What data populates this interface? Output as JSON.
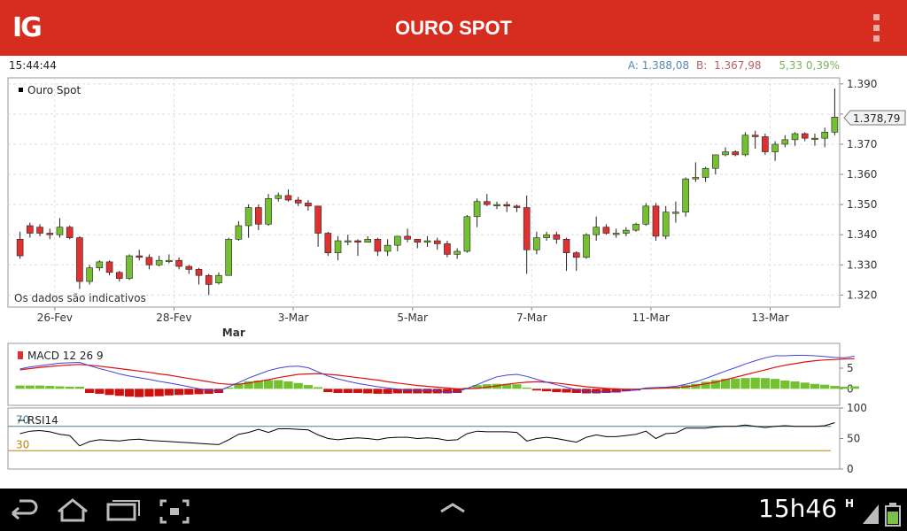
{
  "header": {
    "logo": "IG",
    "title": "OURO SPOT",
    "menu_icon": "overflow-menu-icon"
  },
  "info": {
    "time": "15:44:44",
    "ask_label": "A:",
    "ask": "1.388,08",
    "bid_label": "B:",
    "bid": "1.367,98",
    "change": "5,33 0,39%"
  },
  "colors": {
    "accent": "#d62d20",
    "up": "#73c030",
    "down": "#e03131",
    "macd": "#4040e0",
    "signal": "#e01010",
    "rsi": "#000000"
  },
  "chart_data": [
    {
      "type": "candlestick",
      "legend": "Ouro Spot",
      "note": "Os dados são indicativos",
      "current_price_label": "1.378,79",
      "current_price": 1378.79,
      "ylim": [
        1316,
        1392
      ],
      "y_ticks": [
        1320,
        1330,
        1340,
        1350,
        1360,
        1370,
        1380,
        1390
      ],
      "y_tick_labels": [
        "1.320",
        "1.330",
        "1.340",
        "1.350",
        "1.360",
        "1.370",
        "1.380",
        "1.390"
      ],
      "x_labels": [
        "26-Fev",
        "28-Fev",
        "3-Mar",
        "5-Mar",
        "7-Mar",
        "11-Mar",
        "13-Mar"
      ],
      "x_label_positions": [
        3.5,
        15.5,
        27.5,
        39.5,
        51.5,
        63.5,
        75.5
      ],
      "month_label": "Mar",
      "month_label_position": 21.5,
      "candles": [
        [
          1338.5,
          1333.0,
          1341.0,
          1332.0
        ],
        [
          1343.0,
          1340.5,
          1344.0,
          1339.0
        ],
        [
          1342.5,
          1340.5,
          1343.5,
          1339.5
        ],
        [
          1340.5,
          1340.0,
          1342.0,
          1338.5
        ],
        [
          1340.0,
          1342.5,
          1345.5,
          1339.0
        ],
        [
          1342.5,
          1339.0,
          1343.0,
          1338.5
        ],
        [
          1339.0,
          1324.5,
          1339.5,
          1322.0
        ],
        [
          1324.5,
          1329.0,
          1330.0,
          1323.5
        ],
        [
          1329.0,
          1331.0,
          1331.5,
          1328.0
        ],
        [
          1331.0,
          1327.5,
          1331.5,
          1326.5
        ],
        [
          1327.5,
          1325.5,
          1328.0,
          1324.5
        ],
        [
          1325.5,
          1333.0,
          1333.5,
          1325.0
        ],
        [
          1333.0,
          1332.5,
          1335.0,
          1331.5
        ],
        [
          1332.5,
          1330.0,
          1333.5,
          1328.5
        ],
        [
          1330.0,
          1331.5,
          1333.0,
          1329.5
        ],
        [
          1331.5,
          1331.5,
          1333.5,
          1330.5
        ],
        [
          1331.5,
          1329.5,
          1332.5,
          1328.5
        ],
        [
          1329.5,
          1328.5,
          1330.0,
          1327.0
        ],
        [
          1328.5,
          1326.5,
          1329.0,
          1323.5
        ],
        [
          1326.5,
          1323.5,
          1327.0,
          1320.0
        ],
        [
          1324.0,
          1326.5,
          1327.5,
          1323.5
        ],
        [
          1326.5,
          1338.5,
          1339.0,
          1326.5
        ],
        [
          1338.5,
          1343.0,
          1344.5,
          1338.0
        ],
        [
          1343.0,
          1349.0,
          1350.0,
          1339.0
        ],
        [
          1349.0,
          1343.5,
          1350.0,
          1341.5
        ],
        [
          1343.5,
          1352.0,
          1353.5,
          1343.0
        ],
        [
          1352.0,
          1353.0,
          1354.0,
          1351.0
        ],
        [
          1353.0,
          1351.5,
          1355.0,
          1351.0
        ],
        [
          1351.5,
          1350.5,
          1352.5,
          1349.5
        ],
        [
          1350.5,
          1349.5,
          1351.5,
          1348.0
        ],
        [
          1349.5,
          1340.5,
          1349.5,
          1336.0
        ],
        [
          1340.5,
          1334.0,
          1341.0,
          1333.0
        ],
        [
          1334.0,
          1338.0,
          1339.5,
          1331.5
        ],
        [
          1338.0,
          1338.0,
          1340.0,
          1336.5
        ],
        [
          1338.0,
          1337.5,
          1338.5,
          1333.0
        ],
        [
          1337.5,
          1338.5,
          1339.5,
          1337.5
        ],
        [
          1338.5,
          1334.5,
          1339.0,
          1333.0
        ],
        [
          1334.5,
          1336.5,
          1338.5,
          1333.0
        ],
        [
          1336.5,
          1339.5,
          1339.5,
          1334.5
        ],
        [
          1339.5,
          1338.5,
          1342.0,
          1337.5
        ],
        [
          1338.5,
          1337.5,
          1338.5,
          1335.5
        ],
        [
          1337.5,
          1338.0,
          1339.5,
          1336.0
        ],
        [
          1338.0,
          1337.0,
          1339.0,
          1335.0
        ],
        [
          1337.0,
          1333.5,
          1338.0,
          1332.5
        ],
        [
          1333.5,
          1334.5,
          1335.5,
          1332.0
        ],
        [
          1334.5,
          1346.0,
          1346.5,
          1334.0
        ],
        [
          1346.0,
          1351.0,
          1352.0,
          1342.5
        ],
        [
          1351.0,
          1350.0,
          1353.5,
          1349.5
        ],
        [
          1350.0,
          1350.0,
          1351.0,
          1348.5
        ],
        [
          1350.0,
          1349.5,
          1351.0,
          1347.5
        ],
        [
          1349.5,
          1349.0,
          1350.0,
          1347.5
        ],
        [
          1349.0,
          1335.0,
          1353.0,
          1327.0
        ],
        [
          1335.0,
          1339.0,
          1341.0,
          1333.5
        ],
        [
          1339.0,
          1340.0,
          1341.0,
          1338.0
        ],
        [
          1340.0,
          1338.5,
          1341.0,
          1337.0
        ],
        [
          1338.5,
          1334.0,
          1339.0,
          1328.0
        ],
        [
          1334.0,
          1332.5,
          1334.5,
          1328.0
        ],
        [
          1332.5,
          1340.0,
          1340.5,
          1332.0
        ],
        [
          1340.0,
          1342.5,
          1346.0,
          1338.0
        ],
        [
          1342.5,
          1340.5,
          1343.5,
          1340.0
        ],
        [
          1340.5,
          1340.5,
          1342.0,
          1339.0
        ],
        [
          1340.5,
          1341.5,
          1342.5,
          1339.5
        ],
        [
          1341.5,
          1343.5,
          1344.0,
          1341.0
        ],
        [
          1343.5,
          1349.5,
          1350.5,
          1343.0
        ],
        [
          1349.5,
          1339.5,
          1350.5,
          1338.0
        ],
        [
          1339.5,
          1347.5,
          1349.5,
          1338.5
        ],
        [
          1347.5,
          1347.5,
          1351.0,
          1344.0
        ],
        [
          1347.5,
          1358.5,
          1359.0,
          1346.0
        ],
        [
          1358.5,
          1359.0,
          1364.0,
          1357.5
        ],
        [
          1359.0,
          1362.0,
          1362.5,
          1357.5
        ],
        [
          1362.0,
          1366.5,
          1366.5,
          1360.0
        ],
        [
          1366.5,
          1367.5,
          1369.0,
          1366.0
        ],
        [
          1367.5,
          1366.5,
          1368.0,
          1366.0
        ],
        [
          1366.5,
          1373.0,
          1374.0,
          1366.0
        ],
        [
          1373.0,
          1372.5,
          1374.5,
          1368.5
        ],
        [
          1372.5,
          1367.5,
          1373.5,
          1366.5
        ],
        [
          1367.5,
          1370.0,
          1371.0,
          1364.5
        ],
        [
          1370.0,
          1371.5,
          1373.0,
          1369.0
        ],
        [
          1371.5,
          1373.5,
          1374.0,
          1369.5
        ],
        [
          1373.5,
          1372.0,
          1374.0,
          1371.0
        ],
        [
          1372.0,
          1372.0,
          1373.5,
          1369.5
        ],
        [
          1372.0,
          1374.0,
          1375.5,
          1369.0
        ],
        [
          1374.0,
          1379.0,
          1388.5,
          1373.0
        ]
      ]
    },
    {
      "type": "line",
      "legend": "MACD 12 26 9",
      "ylim": [
        -4,
        11
      ],
      "y_ticks": [
        0,
        5
      ],
      "y_tick_labels": [
        "0",
        "5"
      ],
      "macd": [
        4.8,
        5.3,
        5.6,
        5.9,
        6.2,
        6.3,
        6.4,
        5.6,
        4.9,
        4.3,
        3.6,
        3.1,
        2.7,
        2.3,
        1.8,
        1.4,
        1.0,
        0.5,
        0.0,
        -0.4,
        -0.6,
        0.5,
        1.5,
        2.6,
        3.5,
        4.4,
        5.0,
        5.4,
        5.5,
        5.1,
        4.1,
        3.1,
        2.4,
        1.8,
        1.3,
        0.9,
        0.5,
        0.2,
        -0.1,
        -0.3,
        -0.4,
        -0.4,
        -0.5,
        -0.8,
        -0.7,
        0.1,
        1.0,
        2.0,
        2.9,
        3.3,
        3.5,
        3.0,
        2.3,
        1.6,
        1.0,
        0.4,
        -0.2,
        -0.6,
        -0.7,
        -0.7,
        -0.6,
        -0.5,
        -0.3,
        0.2,
        0.3,
        0.4,
        0.6,
        1.1,
        1.7,
        2.5,
        3.4,
        4.3,
        5.1,
        6.0,
        6.8,
        7.5,
        8.0,
        8.0,
        8.1,
        8.1,
        8.0,
        7.8,
        7.6,
        7.5,
        7.9
      ],
      "signal": [
        4.6,
        4.9,
        5.2,
        5.4,
        5.6,
        5.8,
        5.9,
        5.7,
        5.5,
        5.2,
        4.9,
        4.6,
        4.3,
        4.0,
        3.6,
        3.3,
        2.9,
        2.5,
        2.1,
        1.7,
        1.3,
        1.1,
        1.1,
        1.4,
        1.8,
        2.2,
        2.7,
        3.1,
        3.5,
        3.6,
        3.7,
        3.5,
        3.3,
        3.0,
        2.7,
        2.4,
        2.1,
        1.7,
        1.4,
        1.1,
        0.8,
        0.6,
        0.4,
        0.2,
        0.0,
        0.0,
        0.1,
        0.4,
        0.7,
        1.1,
        1.4,
        1.6,
        1.7,
        1.6,
        1.4,
        1.1,
        0.8,
        0.5,
        0.3,
        0.1,
        0.0,
        -0.1,
        -0.1,
        0.0,
        0.1,
        0.2,
        0.3,
        0.5,
        0.8,
        1.2,
        1.6,
        2.2,
        2.8,
        3.4,
        4.0,
        4.6,
        5.2,
        5.7,
        6.1,
        6.5,
        6.8,
        7.0,
        7.1,
        7.2,
        7.3
      ],
      "histogram": [
        0.8,
        0.8,
        0.8,
        0.7,
        0.6,
        0.5,
        0.5,
        -1.0,
        -1.2,
        -1.5,
        -1.7,
        -1.9,
        -2.0,
        -1.9,
        -1.8,
        -1.6,
        -1.5,
        -1.4,
        -1.3,
        -1.2,
        -1.0,
        0.3,
        1.3,
        1.8,
        2.0,
        2.1,
        2.1,
        1.8,
        1.4,
        0.9,
        0.4,
        -0.8,
        -1.0,
        -1.0,
        -1.0,
        -1.1,
        -1.2,
        -1.2,
        -1.1,
        -1.1,
        -1.1,
        -1.1,
        -1.1,
        -1.1,
        -1.0,
        0.3,
        0.9,
        1.1,
        1.2,
        1.2,
        1.1,
        0.3,
        -0.4,
        -0.6,
        -0.8,
        -0.9,
        -1.0,
        -1.1,
        -1.1,
        -1.0,
        -0.9,
        -0.6,
        -0.4,
        0.2,
        0.3,
        0.4,
        0.5,
        0.9,
        1.2,
        1.7,
        2.1,
        2.4,
        2.5,
        2.6,
        2.7,
        2.6,
        2.4,
        2.0,
        1.8,
        1.5,
        1.2,
        1.0,
        0.7,
        0.5,
        0.6
      ]
    },
    {
      "type": "line",
      "legend": "RSI14",
      "ylim": [
        0,
        100
      ],
      "y_ticks": [
        0,
        50,
        100
      ],
      "y_tick_labels": [
        "0",
        "50",
        "100"
      ],
      "levels": [
        70,
        30
      ],
      "level_labels": [
        "70",
        "30"
      ],
      "values": [
        58,
        62,
        63,
        61,
        57,
        55,
        38,
        45,
        48,
        47,
        46,
        48,
        49,
        47,
        46,
        45,
        44,
        43,
        42,
        41,
        40,
        48,
        57,
        60,
        65,
        60,
        66,
        66,
        65,
        64,
        56,
        50,
        48,
        50,
        51,
        50,
        48,
        51,
        52,
        52,
        50,
        51,
        50,
        47,
        48,
        58,
        62,
        61,
        61,
        61,
        60,
        46,
        50,
        52,
        50,
        47,
        44,
        52,
        56,
        53,
        53,
        55,
        57,
        62,
        50,
        58,
        59,
        67,
        67,
        67,
        69,
        70,
        70,
        72,
        70,
        68,
        70,
        71,
        70,
        70,
        70,
        71,
        76
      ]
    }
  ],
  "nav": {
    "clock": "15h46",
    "back_icon": "back-icon",
    "home_icon": "home-icon",
    "recents_icon": "recent-apps-icon",
    "screenshot_icon": "screenshot-icon",
    "up_icon": "chevron-up-icon",
    "signal_icon": "signal-icon",
    "battery_icon": "battery-icon",
    "network_label": "H"
  }
}
